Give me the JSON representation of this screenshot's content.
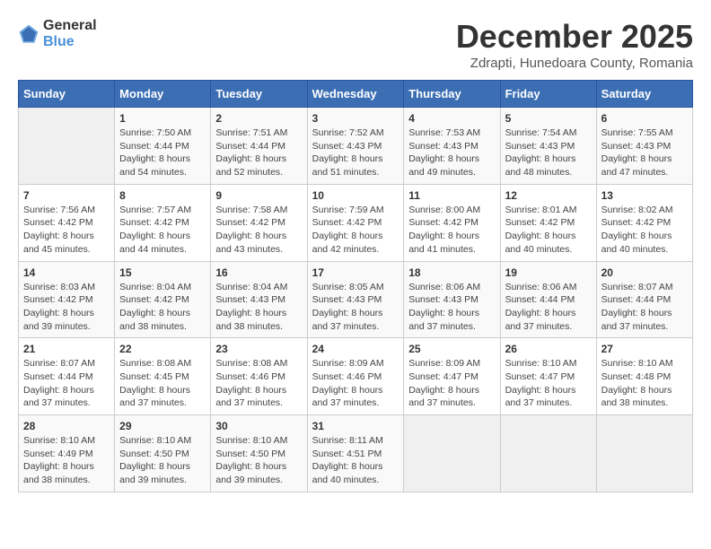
{
  "header": {
    "logo_general": "General",
    "logo_blue": "Blue",
    "month_title": "December 2025",
    "location": "Zdrapti, Hunedoara County, Romania"
  },
  "weekdays": [
    "Sunday",
    "Monday",
    "Tuesday",
    "Wednesday",
    "Thursday",
    "Friday",
    "Saturday"
  ],
  "weeks": [
    [
      {
        "day": "",
        "info": ""
      },
      {
        "day": "1",
        "info": "Sunrise: 7:50 AM\nSunset: 4:44 PM\nDaylight: 8 hours\nand 54 minutes."
      },
      {
        "day": "2",
        "info": "Sunrise: 7:51 AM\nSunset: 4:44 PM\nDaylight: 8 hours\nand 52 minutes."
      },
      {
        "day": "3",
        "info": "Sunrise: 7:52 AM\nSunset: 4:43 PM\nDaylight: 8 hours\nand 51 minutes."
      },
      {
        "day": "4",
        "info": "Sunrise: 7:53 AM\nSunset: 4:43 PM\nDaylight: 8 hours\nand 49 minutes."
      },
      {
        "day": "5",
        "info": "Sunrise: 7:54 AM\nSunset: 4:43 PM\nDaylight: 8 hours\nand 48 minutes."
      },
      {
        "day": "6",
        "info": "Sunrise: 7:55 AM\nSunset: 4:43 PM\nDaylight: 8 hours\nand 47 minutes."
      }
    ],
    [
      {
        "day": "7",
        "info": "Sunrise: 7:56 AM\nSunset: 4:42 PM\nDaylight: 8 hours\nand 45 minutes."
      },
      {
        "day": "8",
        "info": "Sunrise: 7:57 AM\nSunset: 4:42 PM\nDaylight: 8 hours\nand 44 minutes."
      },
      {
        "day": "9",
        "info": "Sunrise: 7:58 AM\nSunset: 4:42 PM\nDaylight: 8 hours\nand 43 minutes."
      },
      {
        "day": "10",
        "info": "Sunrise: 7:59 AM\nSunset: 4:42 PM\nDaylight: 8 hours\nand 42 minutes."
      },
      {
        "day": "11",
        "info": "Sunrise: 8:00 AM\nSunset: 4:42 PM\nDaylight: 8 hours\nand 41 minutes."
      },
      {
        "day": "12",
        "info": "Sunrise: 8:01 AM\nSunset: 4:42 PM\nDaylight: 8 hours\nand 40 minutes."
      },
      {
        "day": "13",
        "info": "Sunrise: 8:02 AM\nSunset: 4:42 PM\nDaylight: 8 hours\nand 40 minutes."
      }
    ],
    [
      {
        "day": "14",
        "info": "Sunrise: 8:03 AM\nSunset: 4:42 PM\nDaylight: 8 hours\nand 39 minutes."
      },
      {
        "day": "15",
        "info": "Sunrise: 8:04 AM\nSunset: 4:42 PM\nDaylight: 8 hours\nand 38 minutes."
      },
      {
        "day": "16",
        "info": "Sunrise: 8:04 AM\nSunset: 4:43 PM\nDaylight: 8 hours\nand 38 minutes."
      },
      {
        "day": "17",
        "info": "Sunrise: 8:05 AM\nSunset: 4:43 PM\nDaylight: 8 hours\nand 37 minutes."
      },
      {
        "day": "18",
        "info": "Sunrise: 8:06 AM\nSunset: 4:43 PM\nDaylight: 8 hours\nand 37 minutes."
      },
      {
        "day": "19",
        "info": "Sunrise: 8:06 AM\nSunset: 4:44 PM\nDaylight: 8 hours\nand 37 minutes."
      },
      {
        "day": "20",
        "info": "Sunrise: 8:07 AM\nSunset: 4:44 PM\nDaylight: 8 hours\nand 37 minutes."
      }
    ],
    [
      {
        "day": "21",
        "info": "Sunrise: 8:07 AM\nSunset: 4:44 PM\nDaylight: 8 hours\nand 37 minutes."
      },
      {
        "day": "22",
        "info": "Sunrise: 8:08 AM\nSunset: 4:45 PM\nDaylight: 8 hours\nand 37 minutes."
      },
      {
        "day": "23",
        "info": "Sunrise: 8:08 AM\nSunset: 4:46 PM\nDaylight: 8 hours\nand 37 minutes."
      },
      {
        "day": "24",
        "info": "Sunrise: 8:09 AM\nSunset: 4:46 PM\nDaylight: 8 hours\nand 37 minutes."
      },
      {
        "day": "25",
        "info": "Sunrise: 8:09 AM\nSunset: 4:47 PM\nDaylight: 8 hours\nand 37 minutes."
      },
      {
        "day": "26",
        "info": "Sunrise: 8:10 AM\nSunset: 4:47 PM\nDaylight: 8 hours\nand 37 minutes."
      },
      {
        "day": "27",
        "info": "Sunrise: 8:10 AM\nSunset: 4:48 PM\nDaylight: 8 hours\nand 38 minutes."
      }
    ],
    [
      {
        "day": "28",
        "info": "Sunrise: 8:10 AM\nSunset: 4:49 PM\nDaylight: 8 hours\nand 38 minutes."
      },
      {
        "day": "29",
        "info": "Sunrise: 8:10 AM\nSunset: 4:50 PM\nDaylight: 8 hours\nand 39 minutes."
      },
      {
        "day": "30",
        "info": "Sunrise: 8:10 AM\nSunset: 4:50 PM\nDaylight: 8 hours\nand 39 minutes."
      },
      {
        "day": "31",
        "info": "Sunrise: 8:11 AM\nSunset: 4:51 PM\nDaylight: 8 hours\nand 40 minutes."
      },
      {
        "day": "",
        "info": ""
      },
      {
        "day": "",
        "info": ""
      },
      {
        "day": "",
        "info": ""
      }
    ]
  ]
}
